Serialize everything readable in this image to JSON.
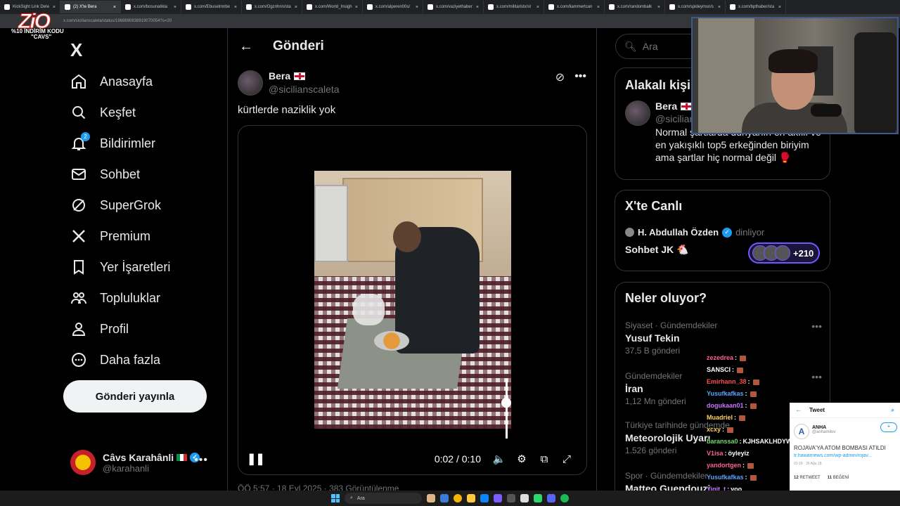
{
  "browser": {
    "tabs": [
      {
        "label": "KickSight Link Dete"
      },
      {
        "label": "(2) X'te Bera"
      },
      {
        "label": "x.com/bosunatikla"
      },
      {
        "label": "x.com/Ebuselmnbe"
      },
      {
        "label": "x.com/Ogznhnn/sta"
      },
      {
        "label": "x.com/World_Insigh"
      },
      {
        "label": "x.com/alperen00s/"
      },
      {
        "label": "x.com/vaziyethaber"
      },
      {
        "label": "x.com/militaristx/st"
      },
      {
        "label": "x.com/liammertcan"
      },
      {
        "label": "x.com/randombalk"
      },
      {
        "label": "x.com/spideymsn/s"
      },
      {
        "label": "x.com/bpthaber/sta"
      }
    ],
    "url": "x.com/sicilianscaleta/status/1968690838919070054?s=20"
  },
  "promo": {
    "brand": "ZiO",
    "line1": "%10 İNDİRİM KODU",
    "line2": "\"CAVS\""
  },
  "nav": {
    "logo": "X",
    "items": [
      {
        "label": "Anasayfa",
        "icon": "home-icon"
      },
      {
        "label": "Keşfet",
        "icon": "search-icon"
      },
      {
        "label": "Bildirimler",
        "icon": "bell-icon",
        "badge": "2"
      },
      {
        "label": "Sohbet",
        "icon": "mail-icon"
      },
      {
        "label": "SuperGrok",
        "icon": "grok-icon"
      },
      {
        "label": "Premium",
        "icon": "x-icon"
      },
      {
        "label": "Yer İşaretleri",
        "icon": "bookmark-icon"
      },
      {
        "label": "Topluluklar",
        "icon": "communities-icon"
      },
      {
        "label": "Profil",
        "icon": "profile-icon"
      },
      {
        "label": "Daha fazla",
        "icon": "more-circle-icon"
      }
    ],
    "post_button": "Gönderi yayınla",
    "account": {
      "name": "Câvs Karahânli",
      "handle": "@karahanli"
    }
  },
  "post": {
    "header_title": "Gönderi",
    "author_name": "Bera",
    "author_handle": "@sicilianscaleta",
    "text": "kürtlerde naziklik yok",
    "video": {
      "time": "0:02 / 0:10",
      "volume_level": 0.6
    },
    "meta": "ÖÖ 5:57 · 18 Eyl 2025 · 383 Görüntülenme"
  },
  "right": {
    "search_placeholder": "Ara",
    "related": {
      "title": "Alakalı kişiler",
      "name": "Bera",
      "handle": "@sicilianscaleta",
      "bio": "Normal şartlarda dünyanın en akıllı ve en yakışıklı top5 erkeğinden biriyim ama şartlar hiç normal değil 🥊"
    },
    "live": {
      "title": "X'te Canlı",
      "host": "H. Abdullah Özden",
      "status": "dinliyor",
      "space": "Sohbet JK 🐔",
      "count": "+210"
    },
    "trends": {
      "title": "Neler oluyor?",
      "items": [
        {
          "category": "Siyaset · Gündemdekiler",
          "name": "Yusuf Tekin",
          "count": "37,5 B gönderi"
        },
        {
          "category": "Gündemdekiler",
          "name": "İran",
          "count": "1,12 Mn gönderi"
        },
        {
          "category": "Türkiye tarihinde gündemde",
          "name": "Meteorolojik Uyarı",
          "count": "1.526 gönderi"
        },
        {
          "category": "Spor · Gündemdekiler",
          "name": "Matteo Guendouzi",
          "count": ""
        }
      ]
    }
  },
  "chat": [
    {
      "user": "zezedrea",
      "color": "#ff5f9a",
      "msg": ""
    },
    {
      "user": "SANSCI",
      "color": "#ffffff",
      "msg": ""
    },
    {
      "user": "Emirhann_38",
      "color": "#ff4d4d",
      "msg": ""
    },
    {
      "user": "Yusufkafkas",
      "color": "#5aa6ff",
      "msg": ""
    },
    {
      "user": "dogukaan01",
      "color": "#c776ff",
      "msg": ""
    },
    {
      "user": "Muadriel",
      "color": "#ffd25a",
      "msg": ""
    },
    {
      "user": "xcxy",
      "color": "#ffd25a",
      "msg": ""
    },
    {
      "user": "baranssa0",
      "color": "#6bdc6b",
      "msg": "KJHSAKLHDYWGEYWGE"
    },
    {
      "user": "V1isa",
      "color": "#ff5f9a",
      "msg": "öyleyiz"
    },
    {
      "user": "yandortgen",
      "color": "#ff5f9a",
      "msg": ""
    },
    {
      "user": "Yusufkafkas",
      "color": "#5aa6ff",
      "msg": ""
    },
    {
      "user": "Yigit_t",
      "color": "#c776ff",
      "msg": "yoo"
    },
    {
      "user": "",
      "color": "#ffffff",
      "msg": "öyleyi"
    }
  ],
  "tweet_widget": {
    "header": "Tweet",
    "account": "ANHA",
    "handle": "@anhamilov",
    "text": "ROJAVA'YA ATOM BOMBASI ATILDI",
    "link": "tr.hawarnews.com/wp-admin/rojav...",
    "date": "01:19 · 26 Ağu 18",
    "retweets": "12",
    "retweets_label": "RETWEET",
    "likes": "11",
    "likes_label": "BEĞENİ"
  },
  "taskbar": {
    "search": "Ara"
  }
}
